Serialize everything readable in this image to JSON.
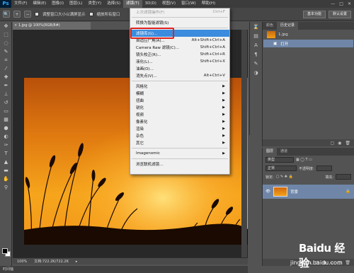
{
  "app": {
    "logo": "Ps"
  },
  "menubar": {
    "items": [
      "文件(F)",
      "编辑(E)",
      "图像(I)",
      "图层(L)",
      "类型(Y)",
      "选择(S)",
      "滤镜(T)",
      "3D(D)",
      "视图(V)",
      "窗口(W)",
      "帮助(H)"
    ],
    "active_index": 6,
    "window_buttons": [
      "—",
      "□",
      "✕"
    ]
  },
  "optbar": {
    "checkbox1_label": "调整窗口大小以满屏显示",
    "checkbox2_label": "缩放所有窗口",
    "workspace_label": "基本功能",
    "workspace_label2": "默认设置"
  },
  "document": {
    "tab_title": "1.jpg @ 100%(RGB/8#)",
    "zoom": "100%",
    "doc_size": "文档:722.2K/722.2K"
  },
  "timeline": {
    "label": "时间轴"
  },
  "history_panel": {
    "tabs": [
      "颜色",
      "历史记录"
    ],
    "snapshot_name": "1.jpg",
    "step_name": "打开"
  },
  "layers_panel": {
    "tabs": [
      "图层",
      "通道"
    ],
    "kind_label": "类型",
    "blend_mode": "正常",
    "opacity_label": "不透明度:",
    "lock_label": "锁定:",
    "fill_label": "填充:",
    "layer_name": "背景"
  },
  "filter_menu": {
    "items": [
      {
        "label": "上次滤镜操作(F)",
        "shortcut": "Ctrl+F",
        "disabled": true
      },
      {
        "sep": true
      },
      {
        "label": "转换为智能滤镜(S)",
        "shortcut": ""
      },
      {
        "sep": true
      },
      {
        "label": "滤镜库(G)...",
        "shortcut": "",
        "highlight": true
      },
      {
        "label": "自适应广角(A)...",
        "shortcut": "Alt+Shift+Ctrl+A"
      },
      {
        "label": "Camera Raw 滤镜(C)...",
        "shortcut": "Shift+Ctrl+A"
      },
      {
        "label": "镜头校正(R)...",
        "shortcut": "Shift+Ctrl+R"
      },
      {
        "label": "液化(L)...",
        "shortcut": "Shift+Ctrl+X"
      },
      {
        "label": "油画(O)...",
        "shortcut": ""
      },
      {
        "label": "消失点(V)...",
        "shortcut": "Alt+Ctrl+V"
      },
      {
        "sep": true
      },
      {
        "label": "风格化",
        "sub": true
      },
      {
        "label": "模糊",
        "sub": true
      },
      {
        "label": "扭曲",
        "sub": true
      },
      {
        "label": "锐化",
        "sub": true
      },
      {
        "label": "视频",
        "sub": true
      },
      {
        "label": "像素化",
        "sub": true
      },
      {
        "label": "渲染",
        "sub": true
      },
      {
        "label": "杂色",
        "sub": true
      },
      {
        "label": "其它",
        "sub": true
      },
      {
        "sep": true
      },
      {
        "label": "Imagenomic",
        "sub": true
      },
      {
        "sep": true
      },
      {
        "label": "浏览联机滤镜...",
        "shortcut": ""
      }
    ]
  },
  "watermark": {
    "text": "Baidu 经验",
    "url": "jingyan.baidu.com"
  },
  "colors": {
    "highlight": "#3b8cde",
    "annotation": "#e0231e",
    "selection": "#6f86a8"
  }
}
